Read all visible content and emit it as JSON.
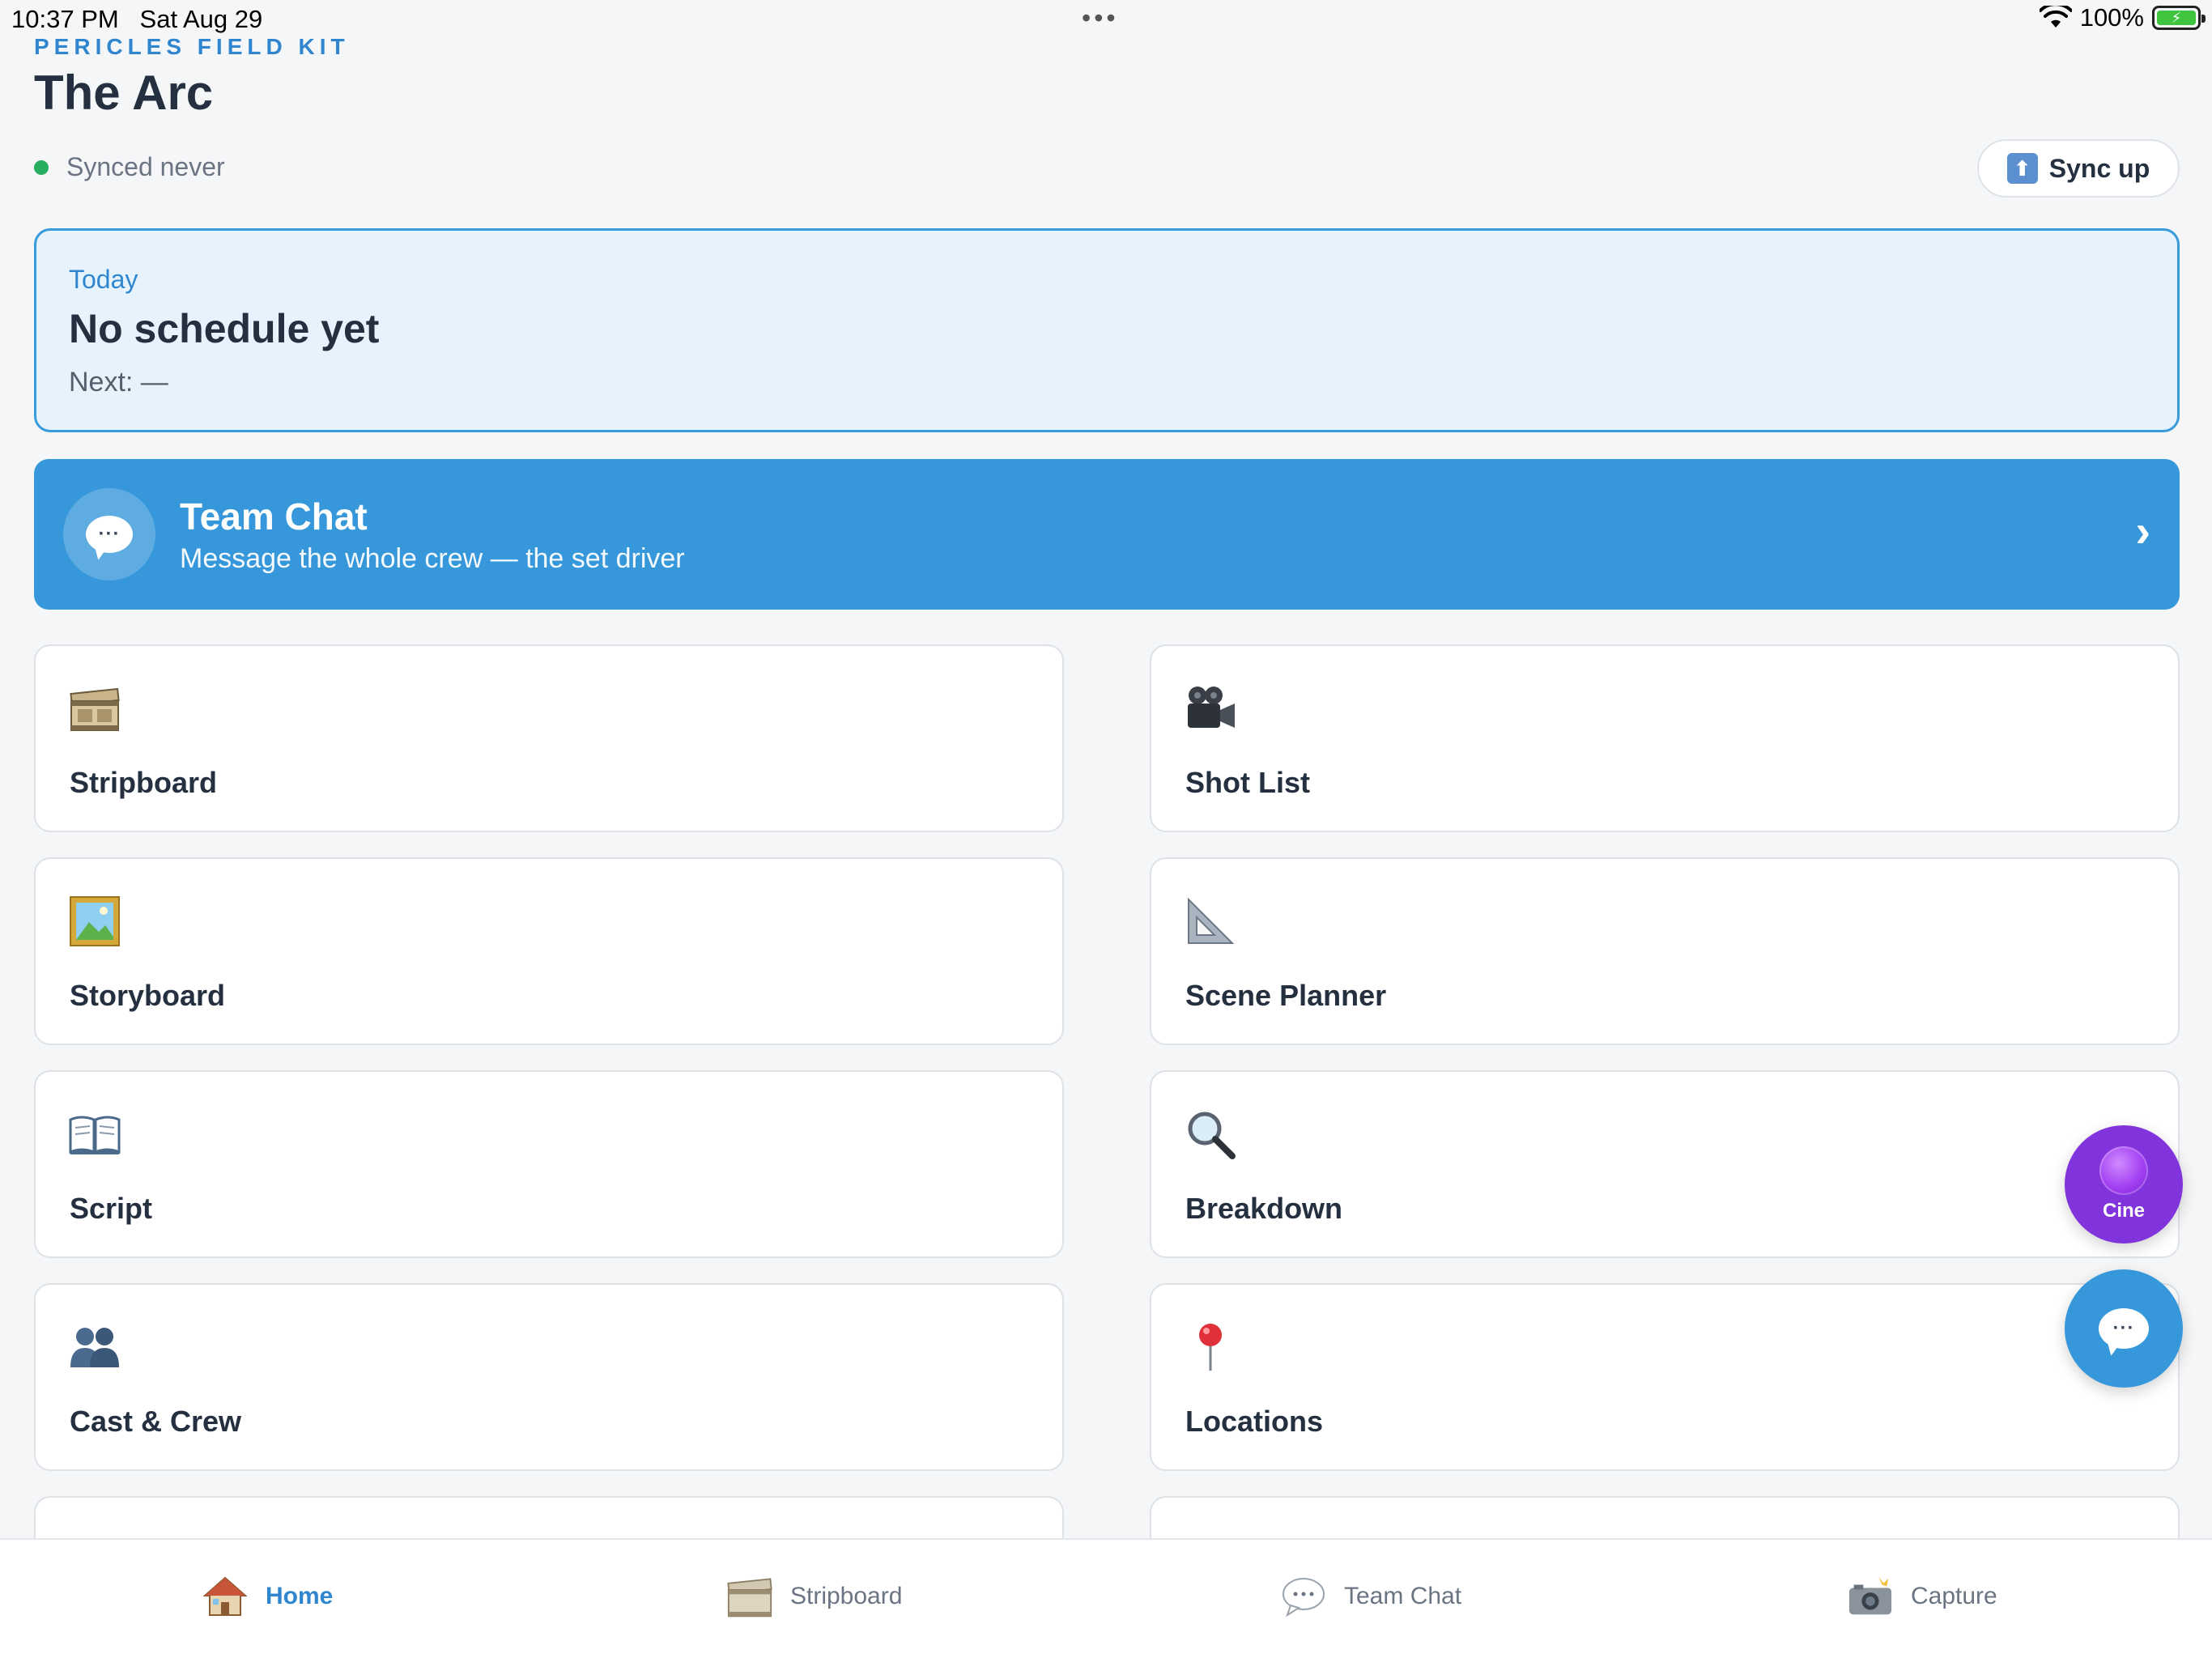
{
  "status_bar": {
    "time": "10:37 PM",
    "date": "Sat Aug 29",
    "dots": "•••",
    "battery": "100%"
  },
  "header": {
    "kit_label": "PERICLES FIELD KIT",
    "project_title": "The Arc",
    "sync_status": "Synced never",
    "sync_button": "Sync up"
  },
  "today": {
    "label": "Today",
    "title": "No schedule yet",
    "next": "Next: —"
  },
  "team_chat_banner": {
    "title": "Team Chat",
    "subtitle": "Message the whole crew — the set driver",
    "chevron": "›"
  },
  "tools": [
    {
      "label": "Stripboard",
      "icon": "film-strip-icon"
    },
    {
      "label": "Shot List",
      "icon": "movie-camera-icon"
    },
    {
      "label": "Storyboard",
      "icon": "framed-picture-icon"
    },
    {
      "label": "Scene Planner",
      "icon": "triangular-ruler-icon"
    },
    {
      "label": "Script",
      "icon": "open-book-icon"
    },
    {
      "label": "Breakdown",
      "icon": "magnifying-glass-icon"
    },
    {
      "label": "Cast & Crew",
      "icon": "people-icon"
    },
    {
      "label": "Locations",
      "icon": "pushpin-icon"
    }
  ],
  "floating": {
    "cine_label": "Cine"
  },
  "tab_bar": [
    {
      "label": "Home",
      "icon": "house-icon",
      "active": true
    },
    {
      "label": "Stripboard",
      "icon": "film-strip-icon",
      "active": false
    },
    {
      "label": "Team Chat",
      "icon": "speech-bubble-icon",
      "active": false
    },
    {
      "label": "Capture",
      "icon": "camera-flash-icon",
      "active": false
    }
  ],
  "colors": {
    "accent": "#3698db",
    "accent_text": "#2f86cf",
    "sync_dot": "#27ae60",
    "cine": "#8133dc",
    "background": "#f5f6f8"
  }
}
